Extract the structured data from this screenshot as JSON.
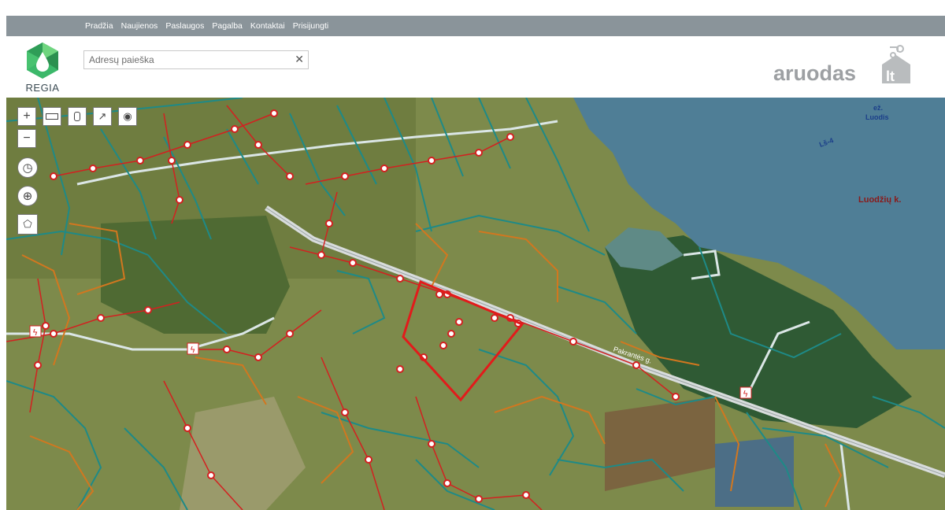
{
  "nav": {
    "items": [
      "Pradžia",
      "Naujienos",
      "Paslaugos",
      "Pagalba",
      "Kontaktai",
      "Prisijungti"
    ]
  },
  "logo": {
    "text": "REGIA"
  },
  "search": {
    "placeholder": "Adresų paieška",
    "value": ""
  },
  "brand": {
    "name": "aruodas",
    "suffix": "lt"
  },
  "map": {
    "labels": {
      "village": "Luodžių k.",
      "lake_prefix": "ež.",
      "lake": "Luodis",
      "lake_code": "Lš-4",
      "street": "Pakrantės g."
    },
    "colors": {
      "water": "#4f7e96",
      "field": "#7f8b4c",
      "parcel_teal": "#1e8a87",
      "parcel_orange": "#d2771f",
      "power_line": "#d32020",
      "highlight_parcel": "#e21b1b",
      "road": "#d8dcdc"
    }
  }
}
